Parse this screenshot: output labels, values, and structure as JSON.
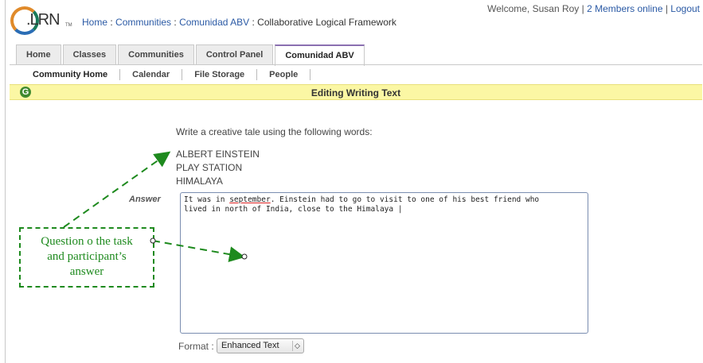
{
  "header": {
    "logo_text": ".LRN",
    "logo_tm": "TM",
    "breadcrumb": {
      "home": "Home",
      "sep1": " : ",
      "communities": "Communities",
      "sep2": " : ",
      "community": "Comunidad ABV",
      "sep3": " : ",
      "current": "Collaborative Logical Framework"
    },
    "welcome": "Welcome, Susan Roy",
    "sep": " | ",
    "members_online": "2 Members online",
    "sep2": " | ",
    "logout": "Logout"
  },
  "tabs": [
    {
      "label": "Home"
    },
    {
      "label": "Classes"
    },
    {
      "label": "Communities"
    },
    {
      "label": "Control Panel"
    },
    {
      "label": "Comunidad ABV"
    }
  ],
  "subnav": [
    {
      "label": "Community Home"
    },
    {
      "label": "Calendar"
    },
    {
      "label": "File Storage"
    },
    {
      "label": "People"
    }
  ],
  "title_bar": {
    "back_icon": "G",
    "title": "Editing Writing Text"
  },
  "content": {
    "question": "Write a creative tale using the following words:",
    "words": [
      "ALBERT EINSTEIN",
      "PLAY STATION",
      "HIMALAYA"
    ],
    "answer_label": "Answer",
    "answer_before": "It was in ",
    "answer_misspelled": "september",
    "answer_after": ". Einstein had to go to visit to one of his best friend who\nlived in north of India, close to the Himalaya |",
    "format_label": "Format :",
    "format_value": "Enhanced Text",
    "format_arrow": "◇"
  },
  "annotation": {
    "line1": "Question o the task",
    "line2": "and participant’s",
    "line3": "answer",
    "color": "#1e8a1e"
  }
}
